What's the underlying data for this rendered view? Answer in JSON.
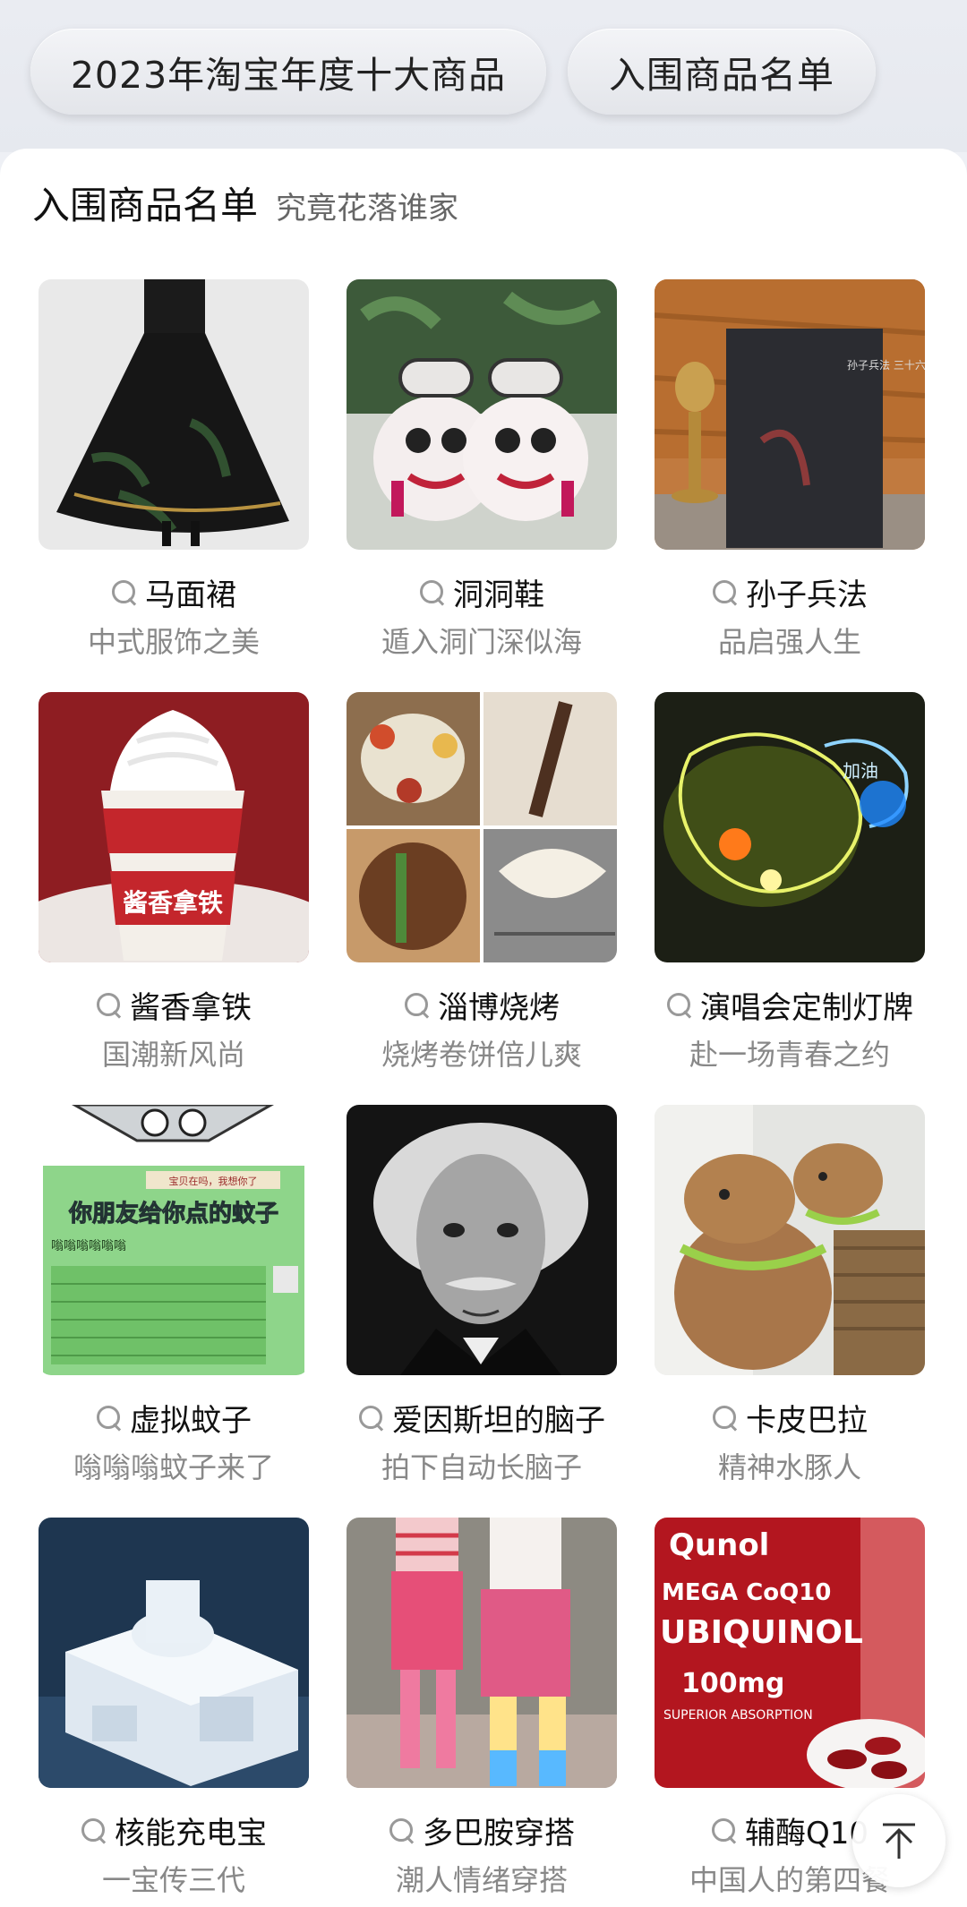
{
  "top_tabs": [
    {
      "label": "2023年淘宝年度十大商品"
    },
    {
      "label": "入围商品名单"
    }
  ],
  "section": {
    "title": "入围商品名单",
    "subtitle": "究竟花落谁家"
  },
  "products": [
    {
      "name": "马面裙",
      "tagline": "中式服饰之美",
      "image": "black-mamian-skirt-photo"
    },
    {
      "name": "洞洞鞋",
      "tagline": "遁入洞门深似海",
      "image": "lion-dance-clogs-photo"
    },
    {
      "name": "孙子兵法",
      "tagline": "品启强人生",
      "image": "sunzi-book-photo"
    },
    {
      "name": "酱香拿铁",
      "tagline": "国潮新风尚",
      "image": "latte-cup-photo"
    },
    {
      "name": "淄博烧烤",
      "tagline": "烧烤卷饼倍儿爽",
      "image": "bbq-collage-photo"
    },
    {
      "name": "演唱会定制灯牌",
      "tagline": "赴一场青春之约",
      "image": "glowing-light-sign-photo"
    },
    {
      "name": "虚拟蚊子",
      "tagline": "嗡嗡嗡蚊子来了",
      "image": "virtual-mosquito-meme"
    },
    {
      "name": "爱因斯坦的脑子",
      "tagline": "拍下自动长脑子",
      "image": "einstein-portrait-photo"
    },
    {
      "name": "卡皮巴拉",
      "tagline": "精神水豚人",
      "image": "capybara-plush-photo"
    },
    {
      "name": "核能充电宝",
      "tagline": "一宝传三代",
      "image": "nuclear-plant-photo"
    },
    {
      "name": "多巴胺穿搭",
      "tagline": "潮人情绪穿搭",
      "image": "dopamine-outfit-photo"
    },
    {
      "name": "辅酶Q10",
      "tagline": "中国人的第四餐",
      "image": "coq10-bottle-photo"
    }
  ],
  "meme_text": {
    "caption": "你朋友给你点的蚊子",
    "buzz": "嗡嗡嗡嗡嗡嗡",
    "banner": "宝贝在吗，我想你了"
  },
  "book_title": "孙子兵法 三十六计",
  "sign_text": "加油",
  "latte_label": "酱香拿铁",
  "bottle": {
    "brand": "Qunol",
    "line1": "MEGA CoQ10",
    "line2": "UBIQUINOL",
    "dose": "100mg",
    "claim": "SUPERIOR ABSORPTION"
  },
  "back_to_top": {
    "icon": "arrow-up-icon"
  },
  "colors": {
    "accent": "#111111",
    "muted": "#888888",
    "icon_gray": "#999999"
  }
}
